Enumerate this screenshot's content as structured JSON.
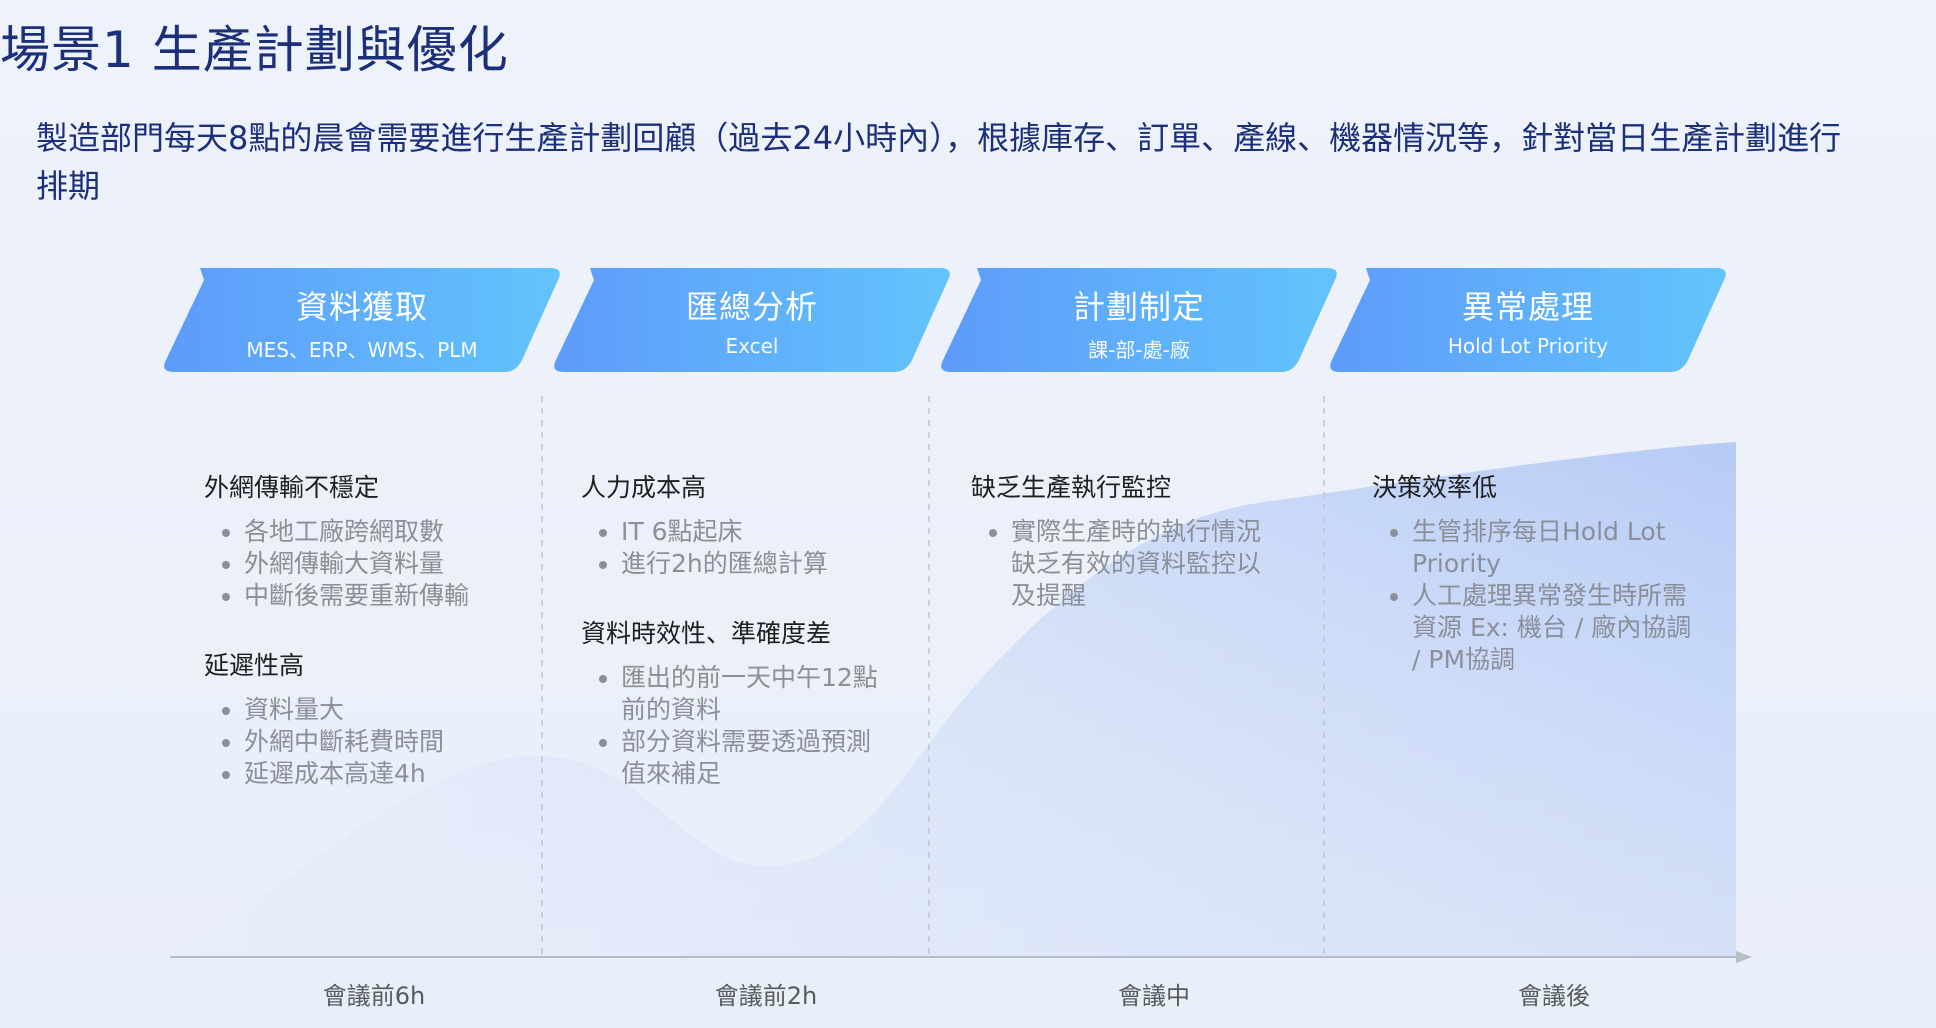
{
  "title": "場景1 生產計劃與優化",
  "description": "製造部門每天8點的晨會需要進行生產計劃回顧（過去24小時內），根據庫存、訂單、產線、機器情況等，針對當日生產計劃進行排期",
  "colors": {
    "title": "#1b2f7a",
    "header_start": "#5e9bfb",
    "header_end": "#62c4fb",
    "area_fill": "#b8cdf6",
    "axis": "#b7bcc7"
  },
  "stages": [
    {
      "title": "資料獲取",
      "subtitle": "MES、ERP、WMS、PLM",
      "blocks": [
        {
          "heading": "外網傳輸不穩定",
          "items": [
            "各地工廠跨網取數",
            "外網傳輸大資料量",
            "中斷後需要重新傳輸"
          ]
        },
        {
          "heading": "延遲性高",
          "items": [
            "資料量大",
            "外網中斷耗費時間",
            "延遲成本高達4h"
          ]
        }
      ]
    },
    {
      "title": "匯總分析",
      "subtitle": "Excel",
      "blocks": [
        {
          "heading": "人力成本高",
          "items": [
            "IT 6點起床",
            "進行2h的匯總計算"
          ]
        },
        {
          "heading": "資料時效性、準確度差",
          "items": [
            "匯出的前一天中午12點前的資料",
            "部分資料需要透過預測值來補足"
          ]
        }
      ]
    },
    {
      "title": "計劃制定",
      "subtitle": "課-部-處-廠",
      "blocks": [
        {
          "heading": "缺乏生產執行監控",
          "items": [
            "實際生產時的執行情況缺乏有效的資料監控以及提醒"
          ]
        }
      ]
    },
    {
      "title": "異常處理",
      "subtitle": "Hold Lot Priority",
      "blocks": [
        {
          "heading": "決策效率低",
          "items": [
            "生管排序每日Hold Lot Priority",
            "人工處理異常發生時所需資源 Ex: 機台 / 廠內協調 / PM協調"
          ]
        }
      ]
    }
  ],
  "timeline": [
    "會議前6h",
    "會議前2h",
    "會議中",
    "會議後"
  ]
}
